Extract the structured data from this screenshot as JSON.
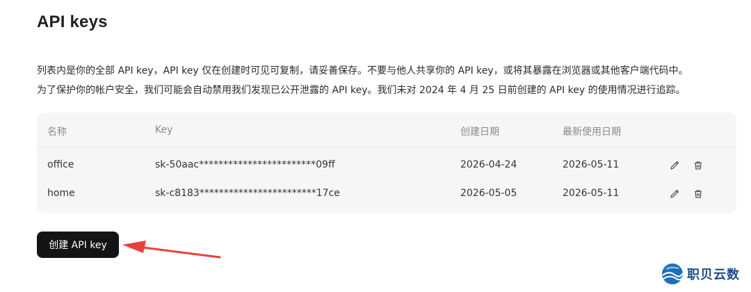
{
  "header": {
    "title": "API keys"
  },
  "description": {
    "line1": "列表内是你的全部 API key，API key 仅在创建时可见可复制，请妥善保存。不要与他人共享你的 API key，或将其暴露在浏览器或其他客户端代码中。",
    "line2": "为了保护你的帐户安全，我们可能会自动禁用我们发现已公开泄露的 API key。我们未对 2024 年 4 月 25 日前创建的 API key 的使用情况进行追踪。"
  },
  "table": {
    "columns": [
      "名称",
      "Key",
      "创建日期",
      "最新使用日期"
    ],
    "rows": [
      {
        "name": "office",
        "key": "sk-50aac************************09ff",
        "created": "2026-04-24",
        "last_used": "2026-05-11"
      },
      {
        "name": "home",
        "key": "sk-c8183************************17ce",
        "created": "2026-05-05",
        "last_used": "2026-05-11"
      }
    ],
    "row_actions": [
      "pencil-icon",
      "trash-icon"
    ]
  },
  "actions": {
    "create_label": "创建 API key"
  },
  "annotation": {
    "arrow_color": "#e8403a"
  },
  "watermark": {
    "brand_text": "职贝云数",
    "brand_color": "#1b4a8c"
  }
}
